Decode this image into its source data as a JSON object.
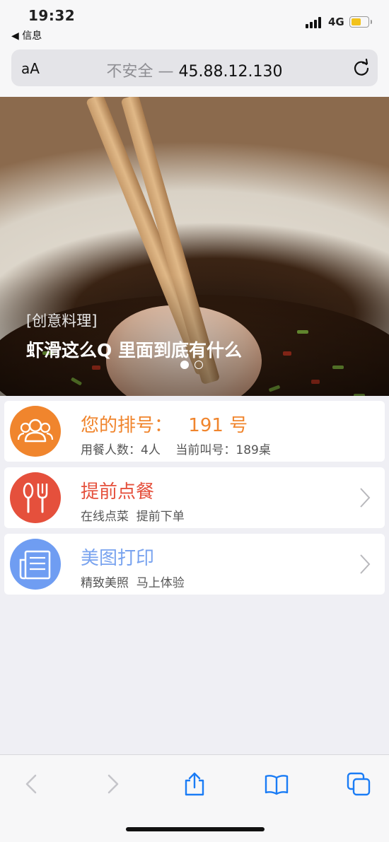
{
  "status_bar": {
    "time": "19:32",
    "back_app": "◀ 信息",
    "network": "4G",
    "battery_color": "#f2c21b"
  },
  "browser": {
    "text_size_icon": "aA",
    "security_label": "不安全",
    "separator": " — ",
    "host": "45.88.12.130",
    "reload_icon": "reload-icon"
  },
  "banner": {
    "tag": "[创意料理]",
    "headline": "虾滑这么Q 里面到底有什么",
    "slides": 2,
    "active_slide": 1
  },
  "cards": [
    {
      "title_prefix": "您的排号：",
      "title_value": "191 号",
      "subtitle": "用餐人数：4人    当前叫号：189桌",
      "icon": "group-users-icon",
      "color": "#f0852d",
      "title_color": "#f0852d"
    },
    {
      "title": "提前点餐",
      "subtitle": "在线点菜  提前下单",
      "icon": "spoon-fork-icon",
      "color": "#e5503c",
      "title_color": "#e5503c"
    },
    {
      "title": "美图打印",
      "subtitle": "精致美照  马上体验",
      "icon": "newspaper-icon",
      "color": "#6f9df2",
      "title_color": "#79a3ef"
    }
  ],
  "toolbar": {
    "items": [
      "back-icon",
      "forward-icon",
      "share-icon",
      "bookmarks-icon",
      "tabs-icon"
    ],
    "accent": "#1a7cf5"
  }
}
